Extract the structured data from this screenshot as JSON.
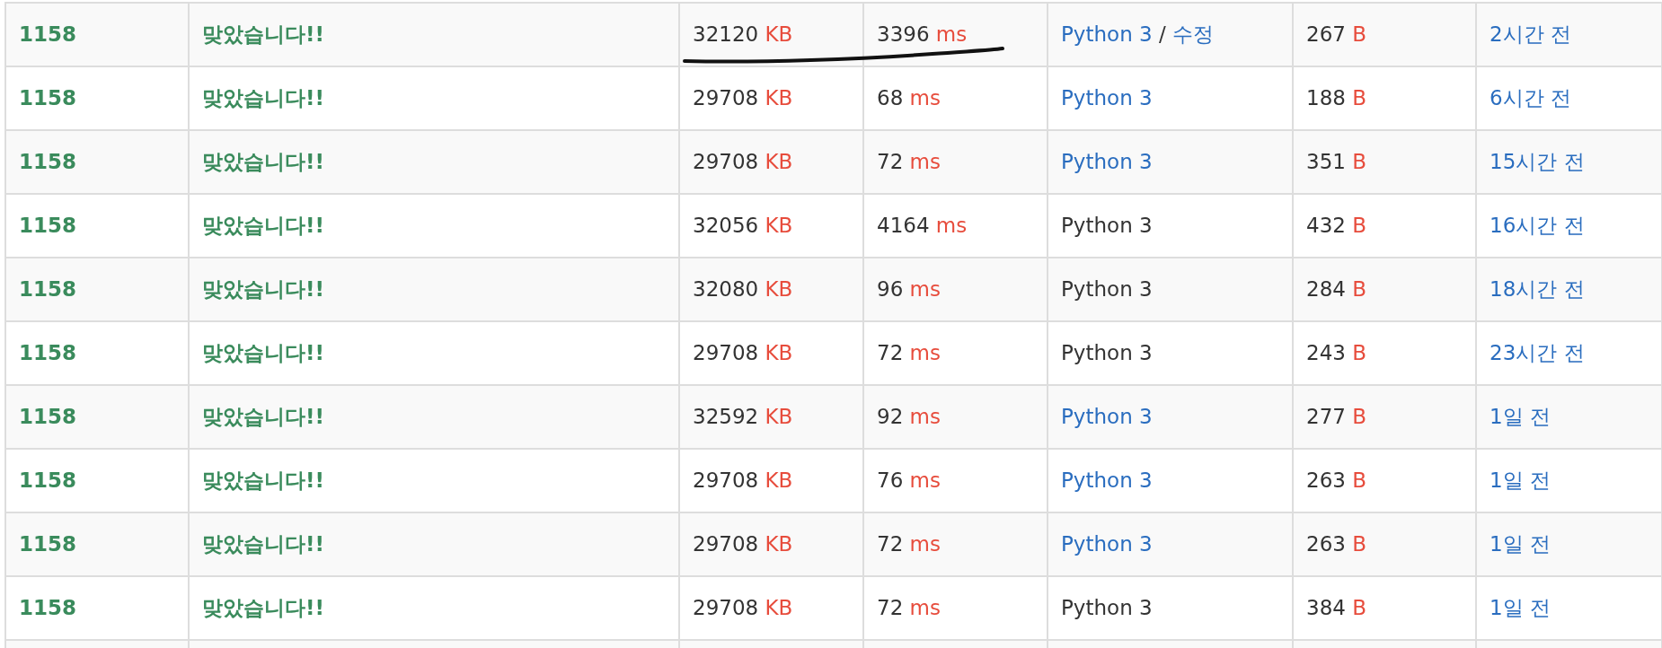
{
  "rows": [
    {
      "problem": "1158",
      "result": "맞았습니다!!",
      "memory": {
        "value": "32120",
        "unit": "KB"
      },
      "time": {
        "value": "3396",
        "unit": "ms"
      },
      "language": {
        "name": "Python 3",
        "link": true,
        "separator": "/",
        "edit": "수정"
      },
      "code_length": {
        "value": "267",
        "unit": "B"
      },
      "submitted": "2시간 전",
      "underlined": true
    },
    {
      "problem": "1158",
      "result": "맞았습니다!!",
      "memory": {
        "value": "29708",
        "unit": "KB"
      },
      "time": {
        "value": "68",
        "unit": "ms"
      },
      "language": {
        "name": "Python 3",
        "link": true
      },
      "code_length": {
        "value": "188",
        "unit": "B"
      },
      "submitted": "6시간 전",
      "underlined": false
    },
    {
      "problem": "1158",
      "result": "맞았습니다!!",
      "memory": {
        "value": "29708",
        "unit": "KB"
      },
      "time": {
        "value": "72",
        "unit": "ms"
      },
      "language": {
        "name": "Python 3",
        "link": true
      },
      "code_length": {
        "value": "351",
        "unit": "B"
      },
      "submitted": "15시간 전",
      "underlined": false
    },
    {
      "problem": "1158",
      "result": "맞았습니다!!",
      "memory": {
        "value": "32056",
        "unit": "KB"
      },
      "time": {
        "value": "4164",
        "unit": "ms"
      },
      "language": {
        "name": "Python 3",
        "link": false
      },
      "code_length": {
        "value": "432",
        "unit": "B"
      },
      "submitted": "16시간 전",
      "underlined": false
    },
    {
      "problem": "1158",
      "result": "맞았습니다!!",
      "memory": {
        "value": "32080",
        "unit": "KB"
      },
      "time": {
        "value": "96",
        "unit": "ms"
      },
      "language": {
        "name": "Python 3",
        "link": false
      },
      "code_length": {
        "value": "284",
        "unit": "B"
      },
      "submitted": "18시간 전",
      "underlined": false
    },
    {
      "problem": "1158",
      "result": "맞았습니다!!",
      "memory": {
        "value": "29708",
        "unit": "KB"
      },
      "time": {
        "value": "72",
        "unit": "ms"
      },
      "language": {
        "name": "Python 3",
        "link": false
      },
      "code_length": {
        "value": "243",
        "unit": "B"
      },
      "submitted": "23시간 전",
      "underlined": false
    },
    {
      "problem": "1158",
      "result": "맞았습니다!!",
      "memory": {
        "value": "32592",
        "unit": "KB"
      },
      "time": {
        "value": "92",
        "unit": "ms"
      },
      "language": {
        "name": "Python 3",
        "link": true
      },
      "code_length": {
        "value": "277",
        "unit": "B"
      },
      "submitted": "1일 전",
      "underlined": false
    },
    {
      "problem": "1158",
      "result": "맞았습니다!!",
      "memory": {
        "value": "29708",
        "unit": "KB"
      },
      "time": {
        "value": "76",
        "unit": "ms"
      },
      "language": {
        "name": "Python 3",
        "link": true
      },
      "code_length": {
        "value": "263",
        "unit": "B"
      },
      "submitted": "1일 전",
      "underlined": false
    },
    {
      "problem": "1158",
      "result": "맞았습니다!!",
      "memory": {
        "value": "29708",
        "unit": "KB"
      },
      "time": {
        "value": "72",
        "unit": "ms"
      },
      "language": {
        "name": "Python 3",
        "link": true
      },
      "code_length": {
        "value": "263",
        "unit": "B"
      },
      "submitted": "1일 전",
      "underlined": false
    },
    {
      "problem": "1158",
      "result": "맞았습니다!!",
      "memory": {
        "value": "29708",
        "unit": "KB"
      },
      "time": {
        "value": "72",
        "unit": "ms"
      },
      "language": {
        "name": "Python 3",
        "link": false
      },
      "code_length": {
        "value": "384",
        "unit": "B"
      },
      "submitted": "1일 전",
      "underlined": false
    }
  ]
}
